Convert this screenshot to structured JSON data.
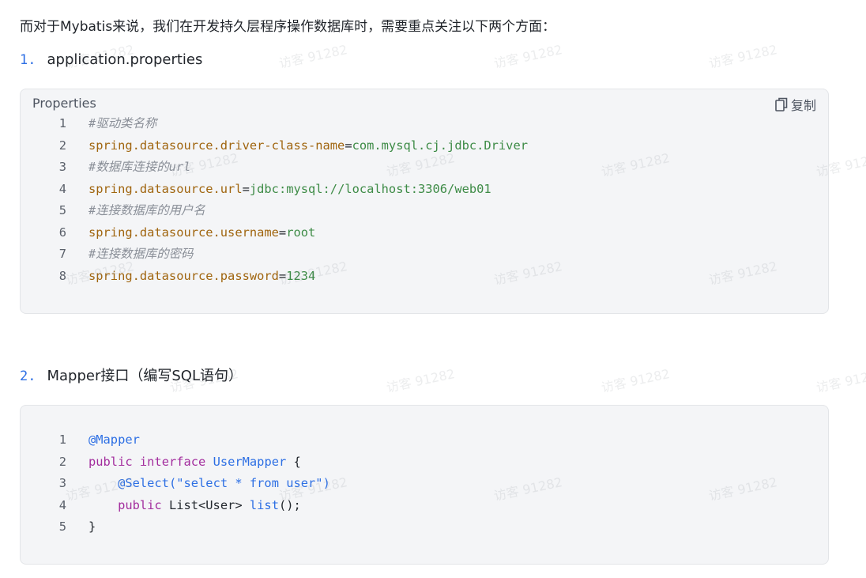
{
  "intro": "而对于Mybatis来说，我们在开发持久层程序操作数据库时，需要重点关注以下两个方面：",
  "watermark": "访客 91282",
  "sections": [
    {
      "number": "1.",
      "title": "application.properties",
      "code_language": "Properties",
      "copy_label": "复制",
      "lines": [
        {
          "no": "1",
          "comment": "#驱动类名称"
        },
        {
          "no": "2",
          "key": "spring.datasource.driver-class-name",
          "eq": "=",
          "value": "com.mysql.cj.jdbc.Driver"
        },
        {
          "no": "3",
          "comment": "#数据库连接的url"
        },
        {
          "no": "4",
          "key": "spring.datasource.url",
          "eq": "=",
          "value": "jdbc:mysql://localhost:3306/web01"
        },
        {
          "no": "5",
          "comment": "#连接数据库的用户名"
        },
        {
          "no": "6",
          "key": "spring.datasource.username",
          "eq": "=",
          "value": "root"
        },
        {
          "no": "7",
          "comment": "#连接数据库的密码"
        },
        {
          "no": "8",
          "key": "spring.datasource.password",
          "eq": "=",
          "value": "1234"
        }
      ]
    },
    {
      "number": "2.",
      "title": "Mapper接口（编写SQL语句）",
      "lines": [
        {
          "no": "1",
          "annotation": "@Mapper"
        },
        {
          "no": "2",
          "kw1": "public",
          "kw2": "interface",
          "type": "UserMapper",
          "rest": " {"
        },
        {
          "no": "3",
          "indent": "    ",
          "annotation": "@Select",
          "paren_open": "(",
          "str": "\"select * from user\"",
          "paren_close": ")"
        },
        {
          "no": "4",
          "indent": "    ",
          "kw1": "public",
          "plain": " List<User> ",
          "fn": "list",
          "rest": "();"
        },
        {
          "no": "5",
          "plain": "}"
        }
      ]
    }
  ],
  "colors": {
    "accent_blue": "#2d6fe4",
    "keyword_purple": "#a32e9e",
    "property_key_brown": "#a0650f",
    "property_value_green": "#3d8b46",
    "comment_gray": "#8a8f98",
    "code_bg": "#f4f5f7"
  }
}
